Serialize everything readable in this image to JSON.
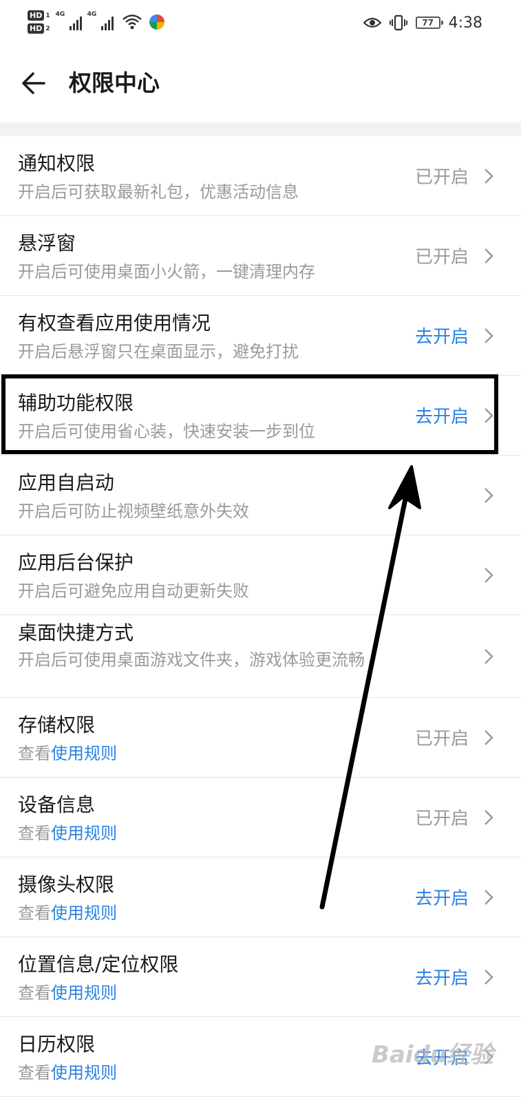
{
  "status_bar": {
    "sim1_label": "HD",
    "sim1_num": "1",
    "sim2_label": "HD",
    "sim2_num": "2",
    "net1": "4G",
    "net2": "4G",
    "battery": "77",
    "time": "4:38"
  },
  "header": {
    "title": "权限中心",
    "back_icon": "arrow-left-icon"
  },
  "items": [
    {
      "title": "通知权限",
      "desc": "开启后可获取最新礼包，优惠活动信息",
      "status": "已开启",
      "enabled": true
    },
    {
      "title": "悬浮窗",
      "desc": "开启后可使用桌面小火箭，一键清理内存",
      "status": "已开启",
      "enabled": true
    },
    {
      "title": "有权查看应用使用情况",
      "desc": "开启后悬浮窗只在桌面显示，避免打扰",
      "status": "去开启",
      "enabled": false
    },
    {
      "title": "辅助功能权限",
      "desc": "开启后可使用省心装，快速安装一步到位",
      "status": "去开启",
      "enabled": false
    },
    {
      "title": "应用自启动",
      "desc": "开启后可防止视频壁纸意外失效",
      "status": "",
      "enabled": null
    },
    {
      "title": "应用后台保护",
      "desc": "开启后可避免应用自动更新失败",
      "status": "",
      "enabled": null
    },
    {
      "title": "桌面快捷方式",
      "desc": "开启后可使用桌面游戏文件夹，游戏体验更流畅",
      "status": "",
      "enabled": null
    },
    {
      "title": "存储权限",
      "desc_prefix": "查看",
      "desc_link": "使用规则",
      "status": "已开启",
      "enabled": true
    },
    {
      "title": "设备信息",
      "desc_prefix": "查看",
      "desc_link": "使用规则",
      "status": "已开启",
      "enabled": true
    },
    {
      "title": "摄像头权限",
      "desc_prefix": "查看",
      "desc_link": "使用规则",
      "status": "去开启",
      "enabled": false
    },
    {
      "title": "位置信息/定位权限",
      "desc_prefix": "查看",
      "desc_link": "使用规则",
      "status": "去开启",
      "enabled": false
    },
    {
      "title": "日历权限",
      "desc_prefix": "查看",
      "desc_link": "使用规则",
      "status": "去开启",
      "enabled": false
    }
  ],
  "watermark": "Baidu经验",
  "colors": {
    "link": "#2a82e4",
    "muted": "#9a9a9a",
    "annotation": "#000000"
  }
}
